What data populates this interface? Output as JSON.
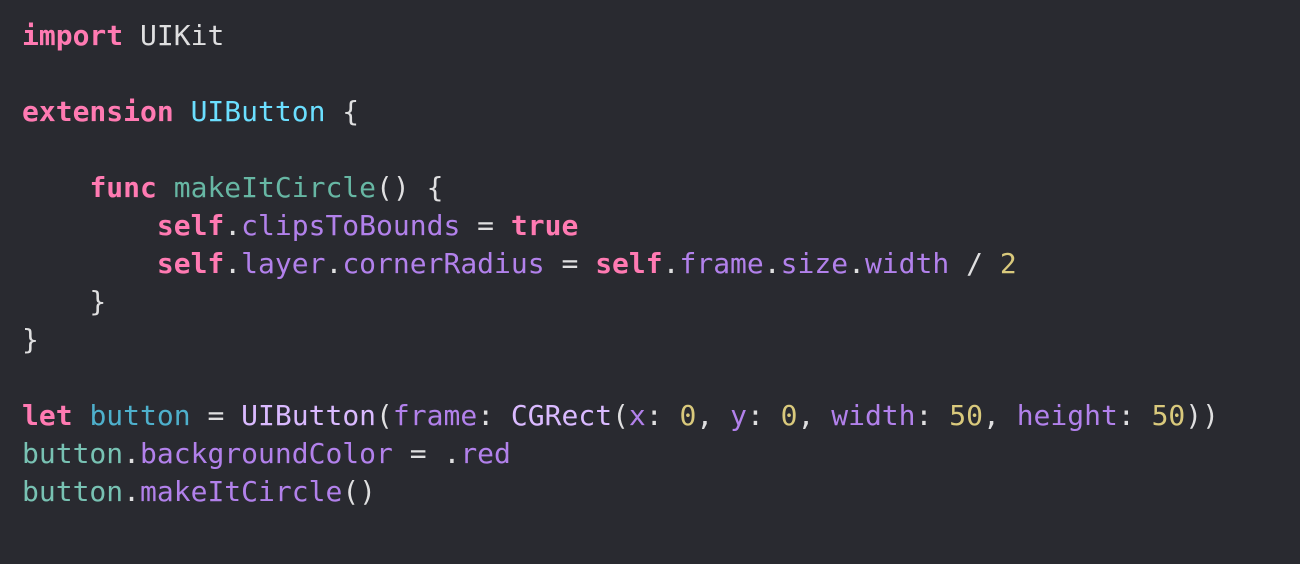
{
  "editor": {
    "colors": {
      "background": "#292a30",
      "keyword": "#ff7ab2",
      "type_declaration": "#6bdfff",
      "function_declaration": "#67b7a4",
      "variable_declaration": "#4eb0cc",
      "property": "#b281eb",
      "system_type": "#dabaff",
      "number": "#d9c97c",
      "plain": "#dfdfe0",
      "project_identifier": "#78c2b3"
    },
    "lines": [
      [
        {
          "t": "import",
          "c": "kw"
        },
        {
          "t": " UIKit",
          "c": "plain"
        }
      ],
      [],
      [
        {
          "t": "extension",
          "c": "kw"
        },
        {
          "t": " ",
          "c": "plain"
        },
        {
          "t": "UIButton",
          "c": "type-decl"
        },
        {
          "t": " {",
          "c": "plain"
        }
      ],
      [],
      [
        {
          "t": "    ",
          "c": "plain"
        },
        {
          "t": "func",
          "c": "kw"
        },
        {
          "t": " ",
          "c": "plain"
        },
        {
          "t": "makeItCircle",
          "c": "func-decl"
        },
        {
          "t": "() {",
          "c": "plain"
        }
      ],
      [
        {
          "t": "        ",
          "c": "plain"
        },
        {
          "t": "self",
          "c": "kw"
        },
        {
          "t": ".",
          "c": "plain"
        },
        {
          "t": "clipsToBounds",
          "c": "prop"
        },
        {
          "t": " = ",
          "c": "plain"
        },
        {
          "t": "true",
          "c": "kw"
        }
      ],
      [
        {
          "t": "        ",
          "c": "plain"
        },
        {
          "t": "self",
          "c": "kw"
        },
        {
          "t": ".",
          "c": "plain"
        },
        {
          "t": "layer",
          "c": "prop"
        },
        {
          "t": ".",
          "c": "plain"
        },
        {
          "t": "cornerRadius",
          "c": "prop"
        },
        {
          "t": " = ",
          "c": "plain"
        },
        {
          "t": "self",
          "c": "kw"
        },
        {
          "t": ".",
          "c": "plain"
        },
        {
          "t": "frame",
          "c": "prop"
        },
        {
          "t": ".",
          "c": "plain"
        },
        {
          "t": "size",
          "c": "prop"
        },
        {
          "t": ".",
          "c": "plain"
        },
        {
          "t": "width",
          "c": "prop"
        },
        {
          "t": " / ",
          "c": "plain"
        },
        {
          "t": "2",
          "c": "num"
        }
      ],
      [
        {
          "t": "    }",
          "c": "plain"
        }
      ],
      [
        {
          "t": "}",
          "c": "plain"
        }
      ],
      [],
      [
        {
          "t": "let",
          "c": "kw"
        },
        {
          "t": " ",
          "c": "plain"
        },
        {
          "t": "button",
          "c": "var-decl"
        },
        {
          "t": " = ",
          "c": "plain"
        },
        {
          "t": "UIButton",
          "c": "sys-type"
        },
        {
          "t": "(",
          "c": "plain"
        },
        {
          "t": "frame",
          "c": "prop"
        },
        {
          "t": ": ",
          "c": "plain"
        },
        {
          "t": "CGRect",
          "c": "sys-type"
        },
        {
          "t": "(",
          "c": "plain"
        },
        {
          "t": "x",
          "c": "prop"
        },
        {
          "t": ": ",
          "c": "plain"
        },
        {
          "t": "0",
          "c": "num"
        },
        {
          "t": ", ",
          "c": "plain"
        },
        {
          "t": "y",
          "c": "prop"
        },
        {
          "t": ": ",
          "c": "plain"
        },
        {
          "t": "0",
          "c": "num"
        },
        {
          "t": ", ",
          "c": "plain"
        },
        {
          "t": "width",
          "c": "prop"
        },
        {
          "t": ": ",
          "c": "plain"
        },
        {
          "t": "50",
          "c": "num"
        },
        {
          "t": ", ",
          "c": "plain"
        },
        {
          "t": "height",
          "c": "prop"
        },
        {
          "t": ": ",
          "c": "plain"
        },
        {
          "t": "50",
          "c": "num"
        },
        {
          "t": "))",
          "c": "plain"
        }
      ],
      [
        {
          "t": "button",
          "c": "proj"
        },
        {
          "t": ".",
          "c": "plain"
        },
        {
          "t": "backgroundColor",
          "c": "prop"
        },
        {
          "t": " = ",
          "c": "plain"
        },
        {
          "t": ".",
          "c": "plain"
        },
        {
          "t": "red",
          "c": "prop"
        }
      ],
      [
        {
          "t": "button",
          "c": "proj"
        },
        {
          "t": ".",
          "c": "plain"
        },
        {
          "t": "makeItCircle",
          "c": "prop"
        },
        {
          "t": "()",
          "c": "plain"
        }
      ]
    ]
  }
}
